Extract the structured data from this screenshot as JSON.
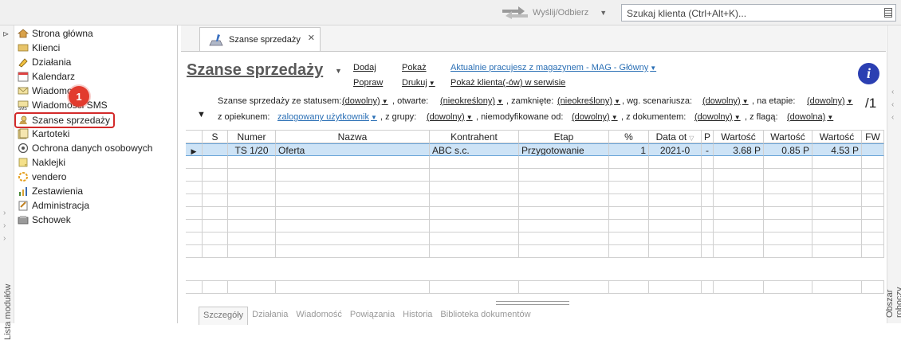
{
  "toolbar": {
    "send_receive_label": "Wyślij/Odbierz",
    "search_placeholder": "Szukaj klienta (Ctrl+Alt+K)..."
  },
  "left_strip": {
    "label": "Lista modułów"
  },
  "right_strip": {
    "label": "Obszar roboczy"
  },
  "nav": {
    "items": [
      {
        "label": "Strona główna",
        "icon": "house-icon"
      },
      {
        "label": "Klienci",
        "icon": "clients-icon"
      },
      {
        "label": "Działania",
        "icon": "actions-icon"
      },
      {
        "label": "Kalendarz",
        "icon": "calendar-icon"
      },
      {
        "label": "Wiadomości",
        "icon": "envelope-icon"
      },
      {
        "label": "Wiadomości SMS",
        "icon": "sms-icon"
      },
      {
        "label": "Szanse sprzedaży",
        "icon": "sales-chance-icon"
      },
      {
        "label": "Kartoteki",
        "icon": "cards-icon"
      },
      {
        "label": "Ochrona danych osobowych",
        "icon": "shield-icon"
      },
      {
        "label": "Naklejki",
        "icon": "sticker-icon"
      },
      {
        "label": "vendero",
        "icon": "vendero-icon"
      },
      {
        "label": "Zestawienia",
        "icon": "report-icon"
      },
      {
        "label": "Administracja",
        "icon": "admin-icon"
      },
      {
        "label": "Schowek",
        "icon": "clipboard-icon"
      }
    ],
    "badge": "1"
  },
  "tab": {
    "label": "Szanse sprzedaży"
  },
  "header": {
    "title": "Szanse sprzedaży",
    "add": "Dodaj",
    "show": "Pokaż",
    "help": "Popraw",
    "print": "Drukuj",
    "employee_link": "Aktualnie pracujesz z magazynem - MAG - Główny",
    "service_link": "Pokaż klienta(-ów) w serwisie"
  },
  "filters": {
    "status_label": "Szanse sprzedaży ze statusem:",
    "status_value": "(dowolny)",
    "open_label": ", otwarte:",
    "open_value": "(nieokreślony)",
    "closed_label": ", zamknięte:",
    "closed_value": "(nieokreślony)",
    "scenario_label": ", wg. scenariusza:",
    "scenario_value": "(dowolny)",
    "stage_label": ", na etapie:",
    "stage_value": "(dowolny)",
    "guardian_label": "z opiekunem:",
    "guardian_value": "zalogowany użytkownik",
    "group_label": ", z grupy:",
    "group_value": "(dowolny)",
    "unmodified_label": ", niemodyfikowane od:",
    "unmodified_value": "(dowolny)",
    "document_label": ", z dokumentem:",
    "document_value": "(dowolny)",
    "flag_label": ", z flagą:",
    "flag_value": "(dowolna)",
    "page_count": "/1"
  },
  "grid": {
    "columns": [
      "S",
      "Numer",
      "Nazwa",
      "Kontrahent",
      "Etap",
      "%",
      "Data ot",
      "P",
      "Wartość",
      "Wartość",
      "Wartość",
      "FW"
    ],
    "rows": [
      {
        "s": "",
        "numer": "TS 1/20",
        "nazwa": "Oferta",
        "kontrahent": "ABC s.c.",
        "etap": "Przygotowanie",
        "procent": "1",
        "data": "2021-0",
        "p": "-",
        "w1": "3.68 P",
        "w2": "0.85 P",
        "w3": "4.53 P",
        "fw": ""
      }
    ]
  },
  "bottom_tabs": [
    "Szczegóły",
    "Działania",
    "Wiadomość",
    "Powiązania",
    "Historia",
    "Biblioteka dokumentów"
  ]
}
